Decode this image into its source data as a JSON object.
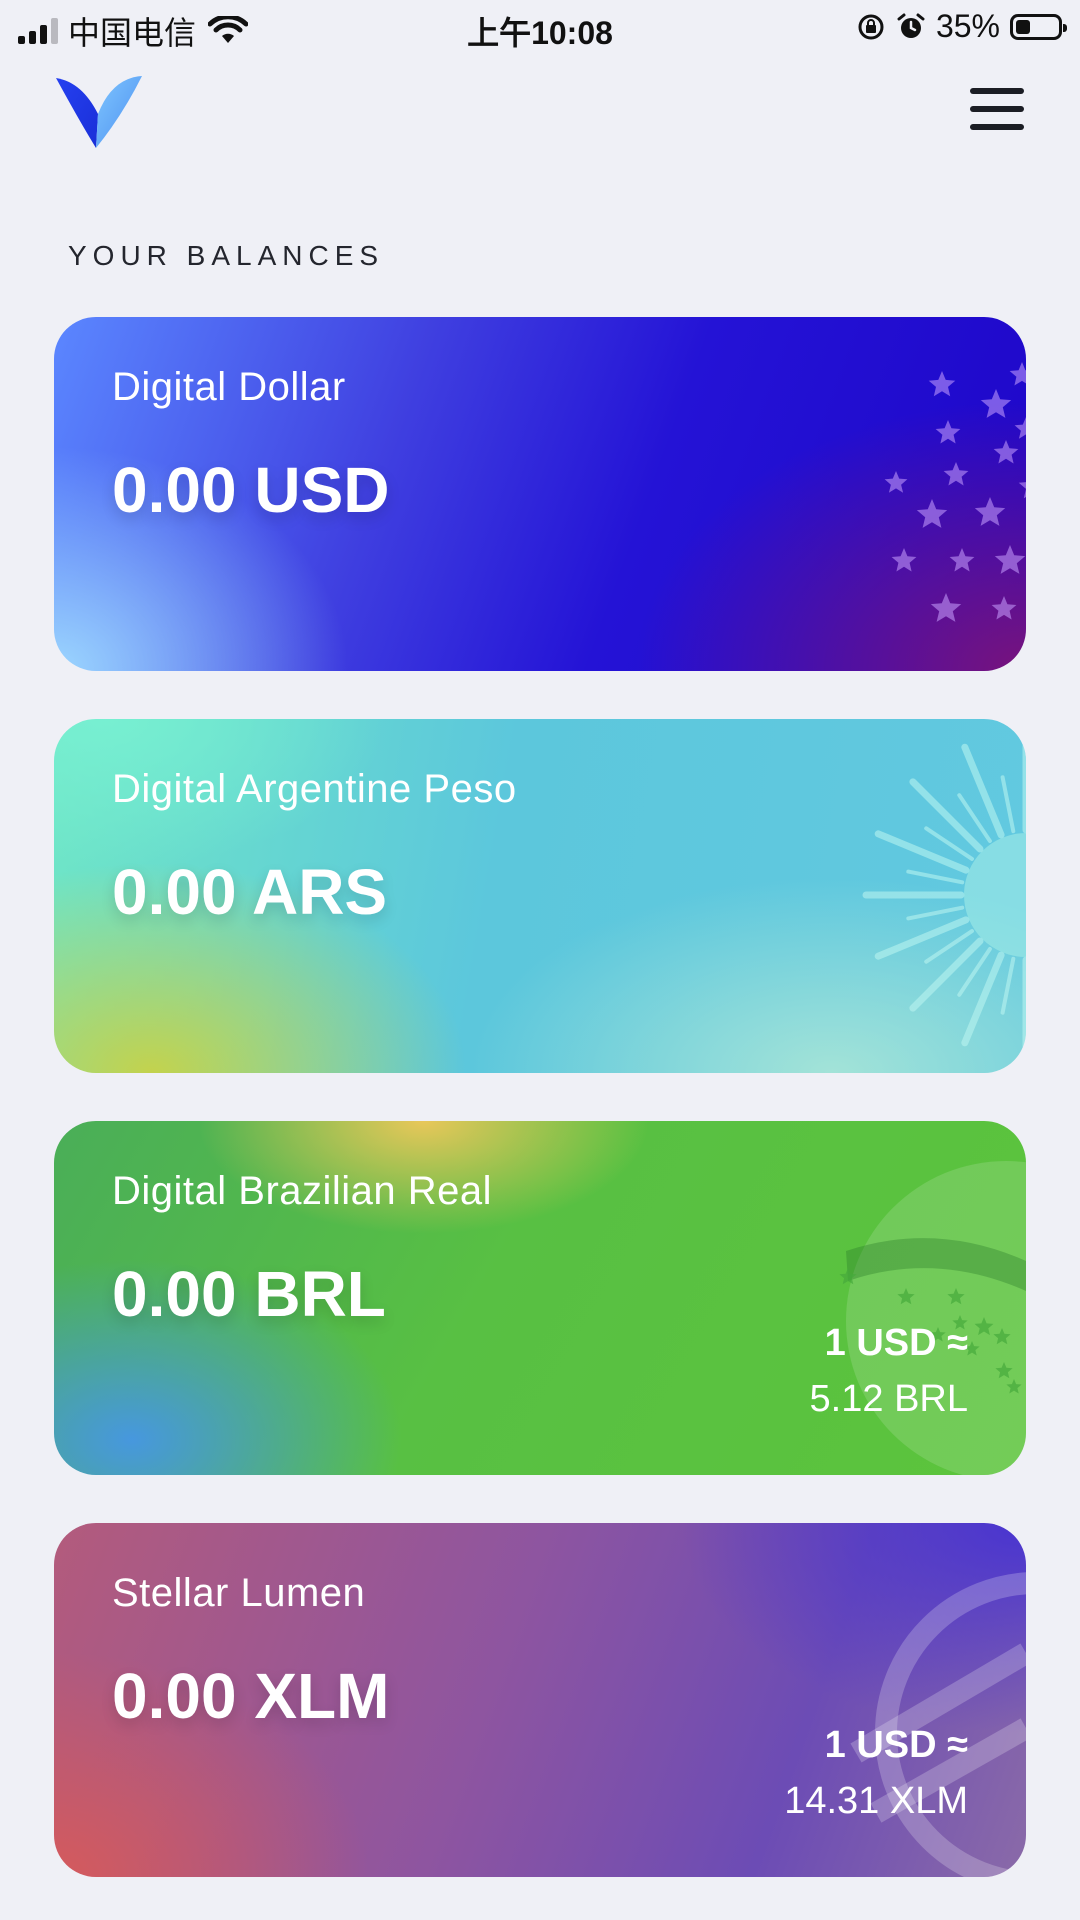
{
  "status_bar": {
    "carrier": "中国电信",
    "time": "上午10:08",
    "battery": "35%",
    "battery_level": 0.35,
    "icons": [
      "signal-icon",
      "wifi-icon",
      "orientation-lock-icon",
      "alarm-icon",
      "battery-icon"
    ]
  },
  "header": {
    "logo": "logo-v-icon",
    "menu_icon": "hamburger-menu-icon",
    "logo_colors": [
      "#2d3df0",
      "#5fa8f5"
    ]
  },
  "section_title": "YOUR BALANCES",
  "balances": [
    {
      "name": "Digital Dollar",
      "amount": "0.00 USD",
      "art": "stars-icon"
    },
    {
      "name": "Digital Argentine Peso",
      "amount": "0.00 ARS",
      "art": "sun-of-may-icon"
    },
    {
      "name": "Digital Brazilian Real",
      "amount": "0.00 BRL",
      "rate_head": "1 USD ≈",
      "rate_value": "5.12 BRL",
      "art": "brazil-globe-icon"
    },
    {
      "name": "Stellar Lumen",
      "amount": "0.00 XLM",
      "rate_head": "1 USD ≈",
      "rate_value": "14.31 XLM",
      "art": "stellar-logo-icon"
    }
  ]
}
